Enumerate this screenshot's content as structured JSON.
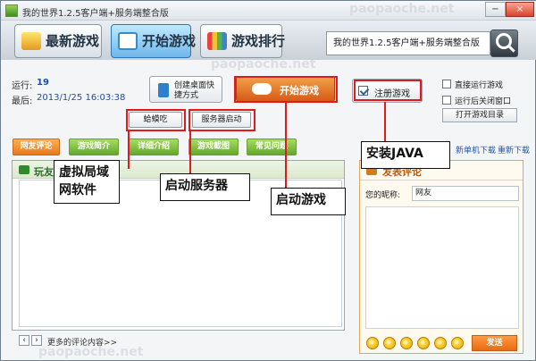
{
  "window": {
    "title": "我的世界1.2.5客户端+服务端整合版",
    "minimize": "−",
    "close": "×"
  },
  "nav": {
    "tabs": [
      {
        "label": "最新游戏",
        "active": false
      },
      {
        "label": "开始游戏",
        "active": true
      },
      {
        "label": "游戏排行",
        "active": false
      }
    ],
    "search_value": "我的世界1.2.5客户端+服务端整合版"
  },
  "info": {
    "run_label": "运行:",
    "run_value": "19",
    "last_label": "最后:",
    "last_value": "2013/1/25 16:03:38"
  },
  "actions": {
    "desktop_shortcut": "创建桌面快捷方式",
    "start_game": "开始游戏",
    "register_game": "注册游戏",
    "run_directly": "直接运行游戏",
    "close_after_run": "运行后关闭窗口",
    "open_game_dir": "打开游戏目录",
    "hamachi": "蛤蟆吃",
    "server_start": "服务器启动"
  },
  "tabs": [
    "网友评论",
    "游戏简介",
    "详细介绍",
    "游戏截图",
    "常见问题"
  ],
  "downloads": {
    "single_download": "新单机下载",
    "redownload": "重新下载"
  },
  "left_panel": {
    "title": "玩友",
    "more_comments": "更多的评论内容>>"
  },
  "right_panel": {
    "title": "发表评论",
    "nickname_label": "您的昵称:",
    "nickname_value": "网友",
    "send": "发送"
  },
  "annotations": {
    "virtual_lan": "虚拟局域网软件",
    "start_server": "启动服务器",
    "start_game": "启动游戏",
    "install_java": "安装JAVA"
  },
  "watermark": "paopaoche.net"
}
